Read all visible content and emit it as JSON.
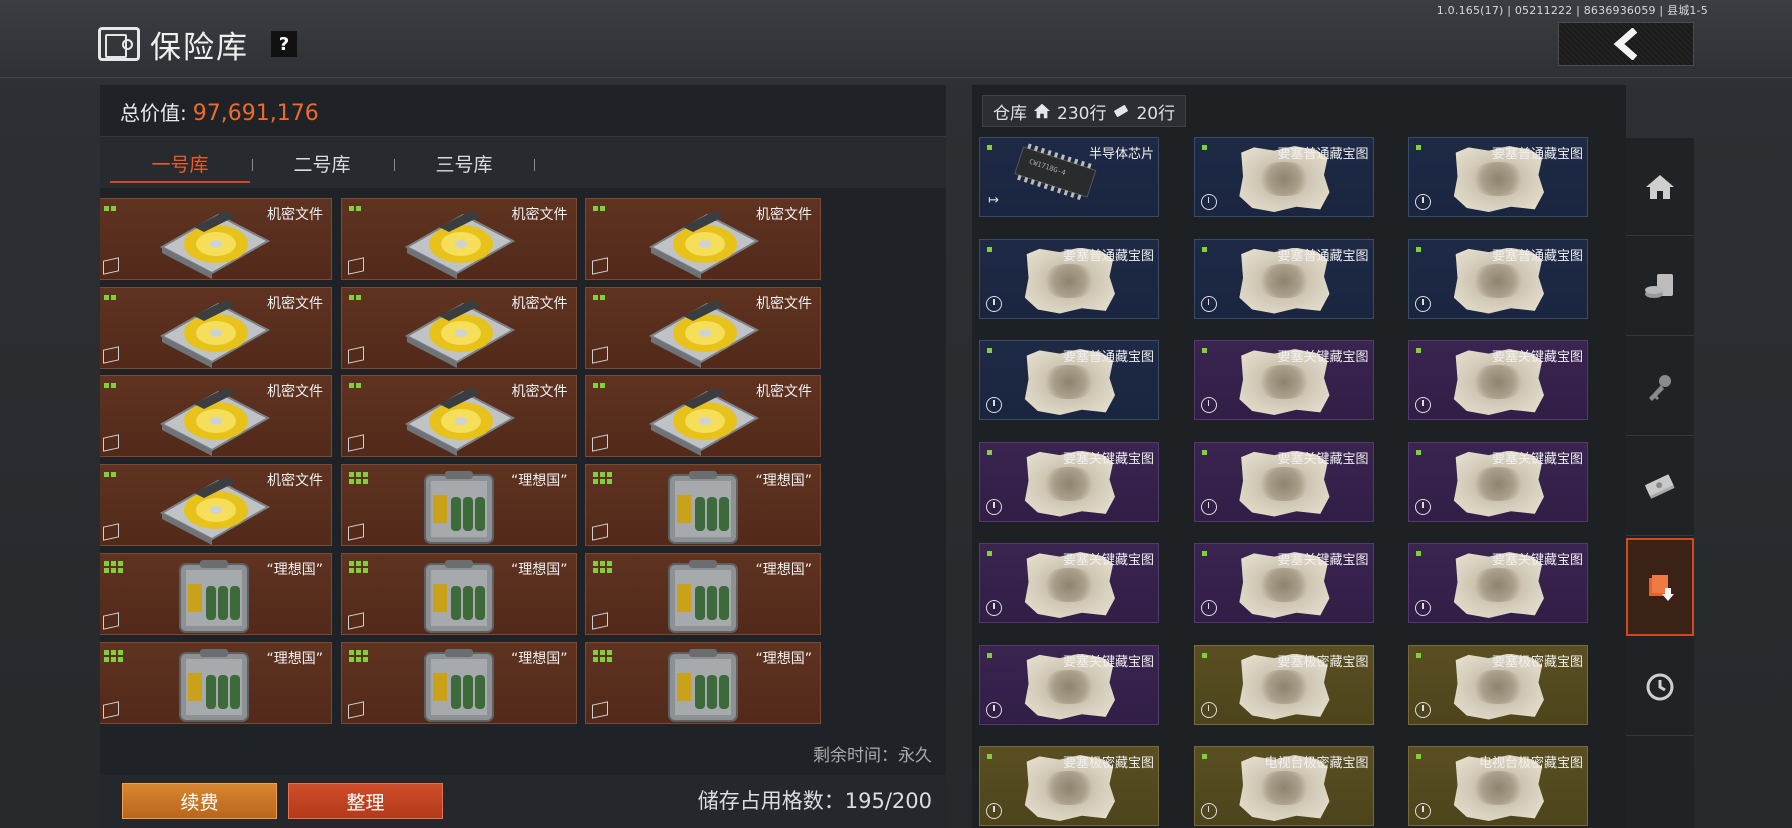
{
  "version": "1.0.165(17) | 05211222 | 8636936059 | 县城1-5",
  "header": {
    "title": "保险库",
    "help": "?"
  },
  "vault": {
    "total_label": "总价值:",
    "total_value": "97,691,176",
    "tabs": [
      {
        "label": "一号库",
        "active": true
      },
      {
        "label": "二号库"
      },
      {
        "label": "三号库"
      }
    ],
    "items": [
      {
        "label": "机密文件",
        "type": "disk"
      },
      {
        "label": "机密文件",
        "type": "disk"
      },
      {
        "label": "机密文件",
        "type": "disk"
      },
      {
        "label": "机密文件",
        "type": "disk"
      },
      {
        "label": "机密文件",
        "type": "disk"
      },
      {
        "label": "机密文件",
        "type": "disk"
      },
      {
        "label": "机密文件",
        "type": "disk"
      },
      {
        "label": "机密文件",
        "type": "disk"
      },
      {
        "label": "机密文件",
        "type": "disk"
      },
      {
        "label": "机密文件",
        "type": "disk"
      },
      {
        "label": "“理想国”",
        "type": "case"
      },
      {
        "label": "“理想国”",
        "type": "case"
      },
      {
        "label": "“理想国”",
        "type": "case"
      },
      {
        "label": "“理想国”",
        "type": "case"
      },
      {
        "label": "“理想国”",
        "type": "case"
      },
      {
        "label": "“理想国”",
        "type": "case"
      },
      {
        "label": "“理想国”",
        "type": "case"
      },
      {
        "label": "“理想国”",
        "type": "case"
      }
    ],
    "remaining": "剩余时间：永久",
    "renew_label": "续费",
    "sort_label": "整理",
    "storage_text": "储存占用格数：195/200"
  },
  "warehouse": {
    "label": "仓库",
    "rows_home": "230行",
    "rows_other": "20行",
    "items": [
      {
        "label": "半导体芯片",
        "rarity": "blue",
        "type": "chip"
      },
      {
        "label": "要塞普通藏宝图",
        "rarity": "blue",
        "type": "map"
      },
      {
        "label": "要塞普通藏宝图",
        "rarity": "blue",
        "type": "map"
      },
      {
        "label": "要塞普通藏宝图",
        "rarity": "blue",
        "type": "map"
      },
      {
        "label": "要塞普通藏宝图",
        "rarity": "blue",
        "type": "map"
      },
      {
        "label": "要塞普通藏宝图",
        "rarity": "blue",
        "type": "map"
      },
      {
        "label": "要塞普通藏宝图",
        "rarity": "blue",
        "type": "map"
      },
      {
        "label": "要塞关键藏宝图",
        "rarity": "purple",
        "type": "map"
      },
      {
        "label": "要塞关键藏宝图",
        "rarity": "purple",
        "type": "map"
      },
      {
        "label": "要塞关键藏宝图",
        "rarity": "purple",
        "type": "map"
      },
      {
        "label": "要塞关键藏宝图",
        "rarity": "purple",
        "type": "map"
      },
      {
        "label": "要塞关键藏宝图",
        "rarity": "purple",
        "type": "map"
      },
      {
        "label": "要塞关键藏宝图",
        "rarity": "purple",
        "type": "map"
      },
      {
        "label": "要塞关键藏宝图",
        "rarity": "purple",
        "type": "map"
      },
      {
        "label": "要塞关键藏宝图",
        "rarity": "purple",
        "type": "map"
      },
      {
        "label": "要塞关键藏宝图",
        "rarity": "purple",
        "type": "map"
      },
      {
        "label": "要塞极密藏宝图",
        "rarity": "gold",
        "type": "map"
      },
      {
        "label": "要塞极密藏宝图",
        "rarity": "gold",
        "type": "map"
      },
      {
        "label": "要塞极密藏宝图",
        "rarity": "gold",
        "type": "map"
      },
      {
        "label": "电视台极密藏宝图",
        "rarity": "gold",
        "type": "map"
      },
      {
        "label": "电视台极密藏宝图",
        "rarity": "gold",
        "type": "map"
      }
    ]
  },
  "sidebar": [
    "home-icon",
    "exchange-icon",
    "key-icon",
    "cash-icon",
    "vault-deposit-icon",
    "clock-icon"
  ],
  "colors": {
    "accent": "#ee6a2e",
    "tab_active": "#ee5a26",
    "vault_cell": "#5a2f1e",
    "blue": "#1e2a45",
    "purple": "#3a2450",
    "gold": "#5a4f22",
    "size_green": "#7fd03a"
  }
}
